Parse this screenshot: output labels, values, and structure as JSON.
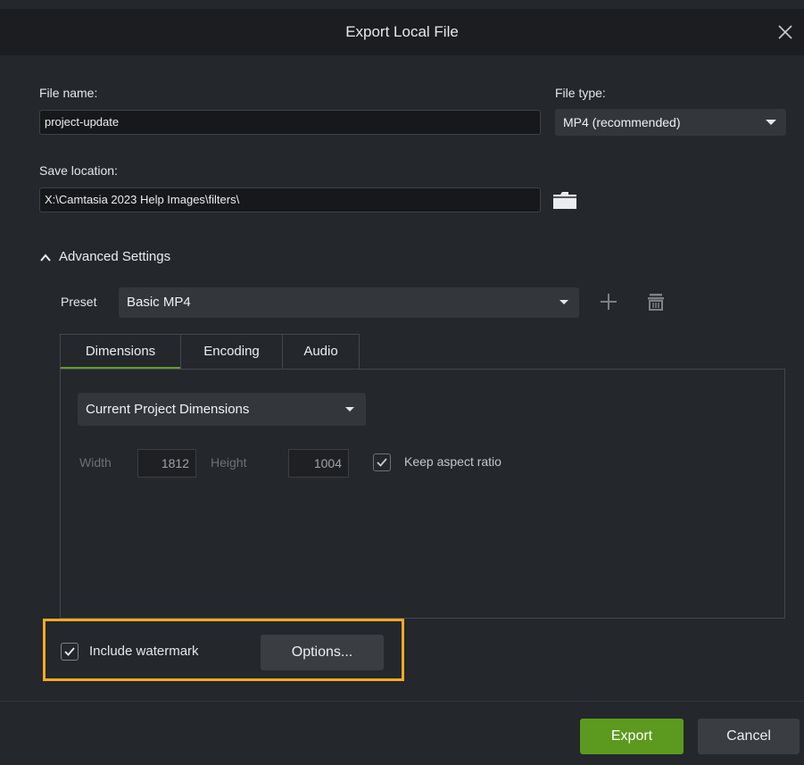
{
  "dialog": {
    "title": "Export Local File"
  },
  "file_name": {
    "label": "File name:",
    "value": "project-update"
  },
  "file_type": {
    "label": "File type:",
    "value": "MP4 (recommended)"
  },
  "save_location": {
    "label": "Save location:",
    "value": "X:\\Camtasia 2023 Help Images\\filters\\"
  },
  "advanced": {
    "label": "Advanced Settings",
    "preset_label": "Preset",
    "preset_value": "Basic MP4",
    "tabs": [
      "Dimensions",
      "Encoding",
      "Audio"
    ],
    "active_tab": "Dimensions"
  },
  "dimensions": {
    "mode": "Current Project Dimensions",
    "width_label": "Width",
    "width_value": "1812",
    "height_label": "Height",
    "height_value": "1004",
    "keep_aspect_label": "Keep aspect ratio",
    "keep_aspect_checked": true
  },
  "watermark": {
    "label": "Include watermark",
    "checked": true,
    "options_label": "Options..."
  },
  "footer": {
    "export_label": "Export",
    "cancel_label": "Cancel"
  },
  "colors": {
    "accent_green": "#5b9a1e",
    "highlight": "#f5a923",
    "background": "#24272c"
  },
  "icons": [
    "close-icon",
    "folder-icon",
    "chevron-up-icon",
    "caret-down-icon",
    "plus-icon",
    "trash-icon",
    "checkmark-icon"
  ]
}
